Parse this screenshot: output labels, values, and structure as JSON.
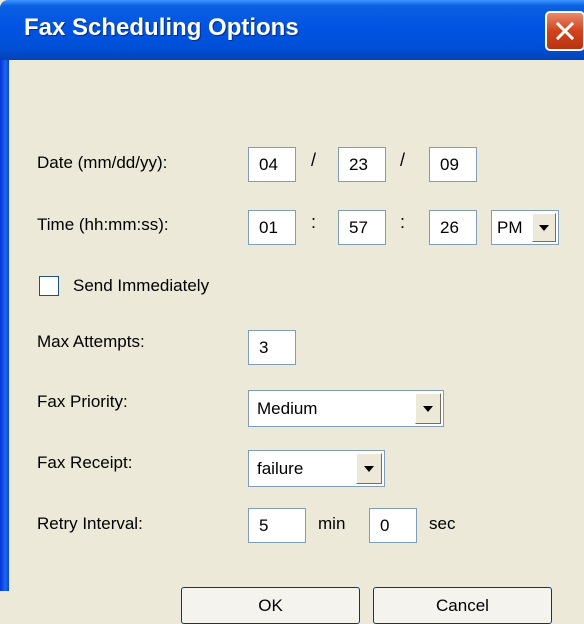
{
  "window": {
    "title": "Fax Scheduling Options",
    "close_icon": "close-icon"
  },
  "date": {
    "label": "Date (mm/dd/yy):",
    "month": "04",
    "day": "23",
    "year": "09",
    "separator": "/"
  },
  "time": {
    "label": "Time (hh:mm:ss):",
    "hour": "01",
    "minute": "57",
    "second": "26",
    "separator": ":",
    "ampm": "PM"
  },
  "send_immediately": {
    "label": "Send Immediately",
    "checked": false
  },
  "max_attempts": {
    "label": "Max Attempts:",
    "value": "3"
  },
  "fax_priority": {
    "label": "Fax Priority:",
    "value": "Medium"
  },
  "fax_receipt": {
    "label": "Fax Receipt:",
    "value": "failure"
  },
  "retry_interval": {
    "label": "Retry Interval:",
    "min_value": "5",
    "min_unit": "min",
    "sec_value": "0",
    "sec_unit": "sec"
  },
  "buttons": {
    "ok": "OK",
    "cancel": "Cancel"
  },
  "colors": {
    "title_bar": "#0054e3",
    "dialog_bg": "#ece9d8",
    "close_button": "#d2431c",
    "field_border": "#7f9db9"
  }
}
